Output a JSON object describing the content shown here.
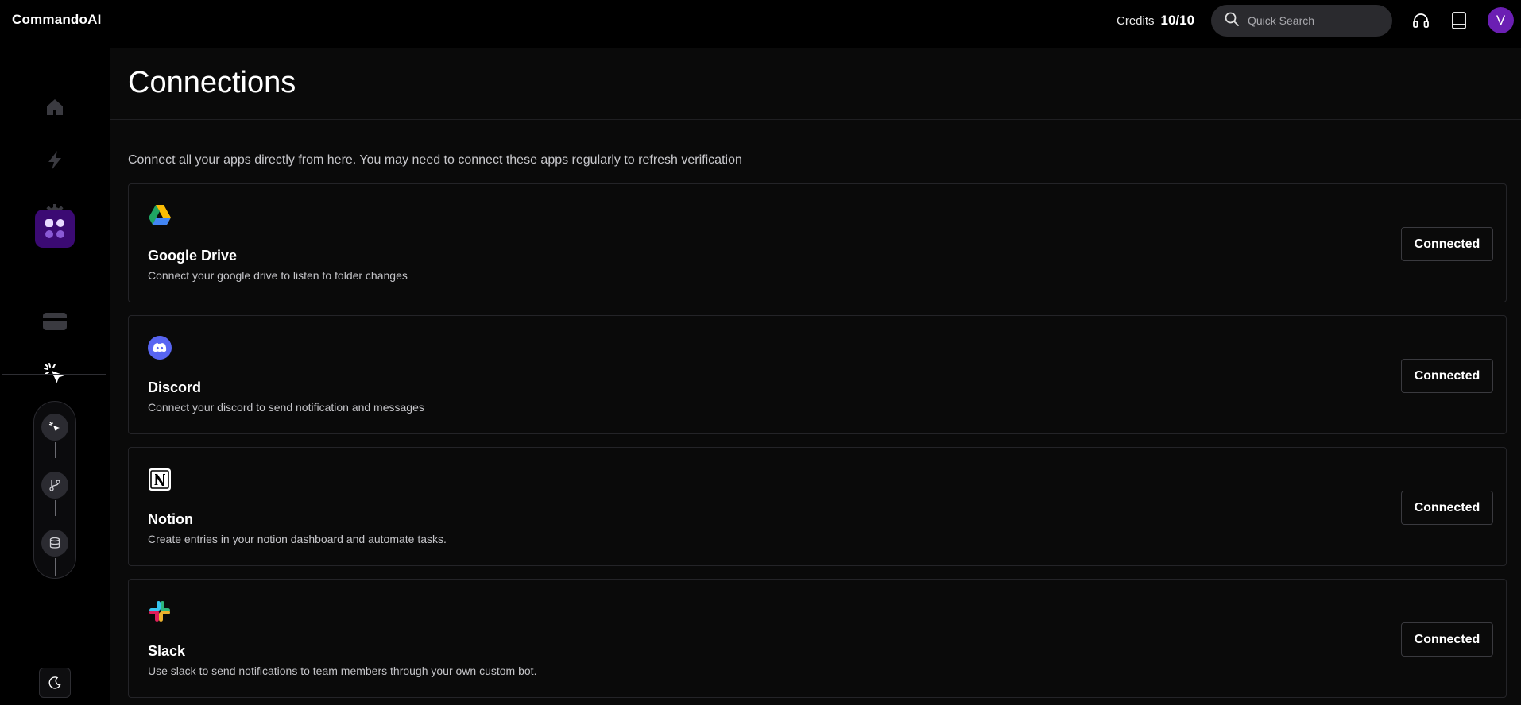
{
  "app": {
    "brand": "CommandoAI",
    "credits_label": "Credits",
    "credits_value": "10/10",
    "search_placeholder": "Quick Search",
    "avatar_initial": "V"
  },
  "sidebar": {
    "items": [
      {
        "name": "home",
        "icon": "home-icon"
      },
      {
        "name": "actions",
        "icon": "lightning-icon"
      },
      {
        "name": "settings",
        "icon": "gear-icon"
      },
      {
        "name": "connections",
        "icon": "apps-grid-icon",
        "active": true
      },
      {
        "name": "billing",
        "icon": "credit-card-icon"
      },
      {
        "name": "automations",
        "icon": "click-cursor-icon"
      }
    ],
    "flow_nodes": [
      "click-cursor-icon",
      "git-branch-icon",
      "database-icon"
    ],
    "theme_icon": "moon-icon"
  },
  "page": {
    "title": "Connections",
    "subtitle": "Connect all your apps directly from here. You may need to connect these apps regularly to refresh verification"
  },
  "connections": [
    {
      "name": "Google Drive",
      "description": "Connect your google drive to listen to folder changes",
      "status": "Connected",
      "icon": "google-drive-icon"
    },
    {
      "name": "Discord",
      "description": "Connect your discord to send notification and messages",
      "status": "Connected",
      "icon": "discord-icon"
    },
    {
      "name": "Notion",
      "description": "Create entries in your notion dashboard and automate tasks.",
      "status": "Connected",
      "icon": "notion-icon"
    },
    {
      "name": "Slack",
      "description": "Use slack to send notifications to team members through your own custom bot.",
      "status": "Connected",
      "icon": "slack-icon"
    }
  ],
  "colors": {
    "accent": "#3b0a73",
    "avatar": "#6b1fb3",
    "background": "#000000",
    "panel": "#0a0a0a"
  }
}
